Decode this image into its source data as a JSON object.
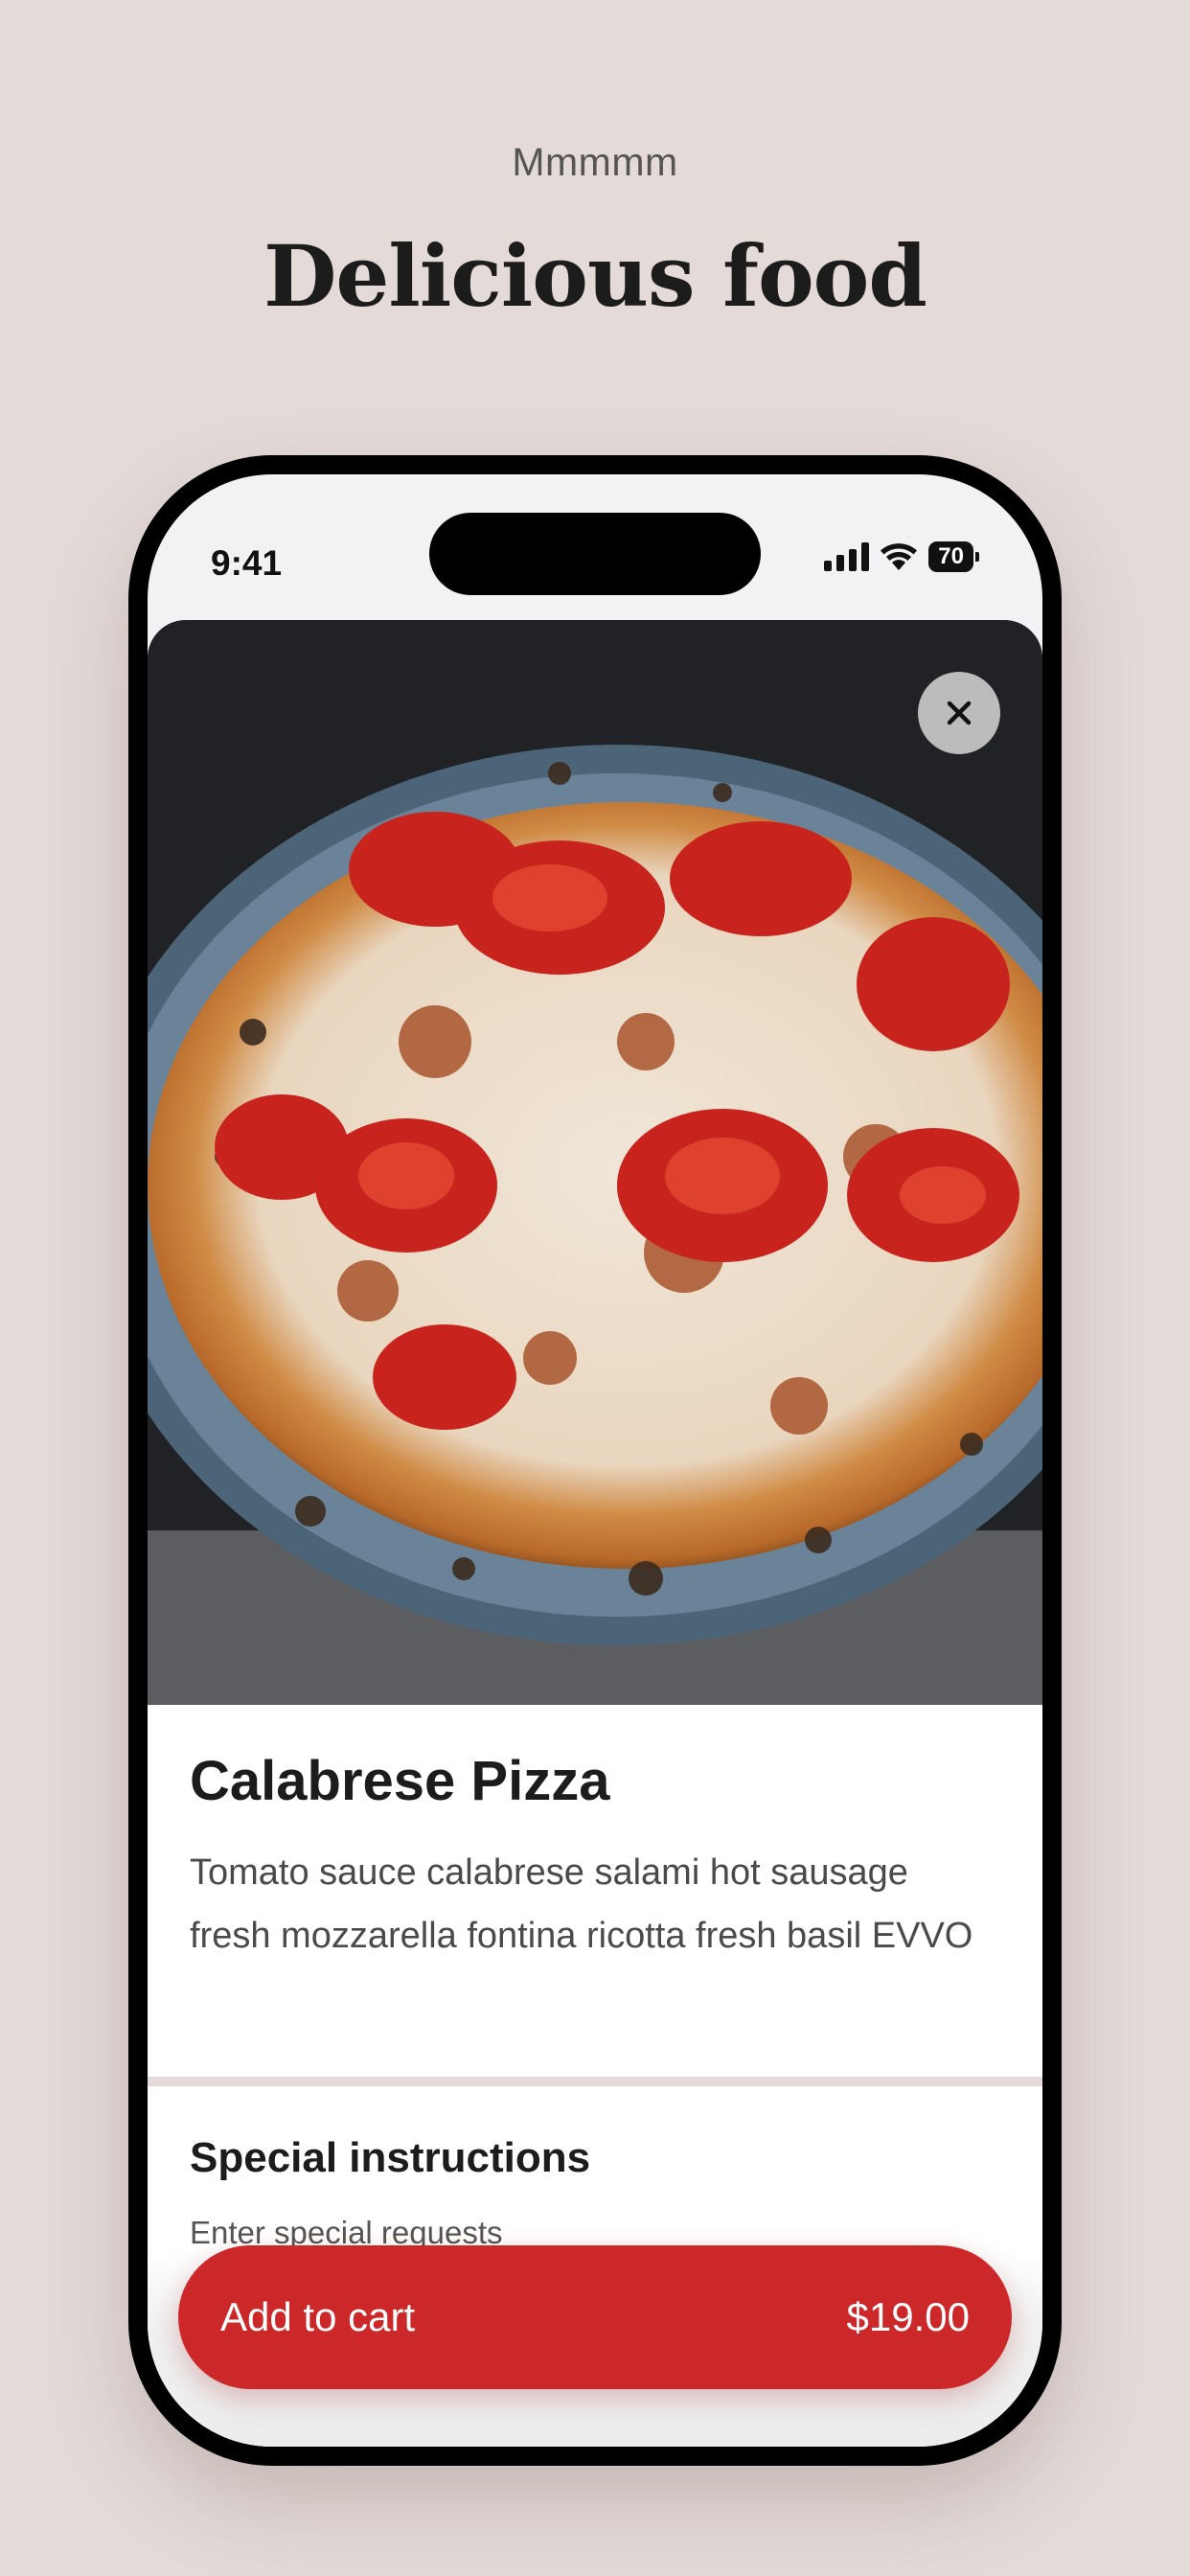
{
  "header": {
    "eyebrow": "Mmmmm",
    "title": "Delicious food"
  },
  "status_bar": {
    "time": "9:41",
    "battery": "70"
  },
  "product": {
    "name": "Calabrese Pizza",
    "description": "Tomato sauce calabrese salami hot sausage fresh mozzarella fontina ricotta fresh basil EVVO"
  },
  "special_instructions": {
    "title": "Special instructions",
    "placeholder": "Enter special requests"
  },
  "cart_button": {
    "label": "Add to cart",
    "price": "$19.00"
  },
  "colors": {
    "accent": "#cd2829",
    "background": "#e4dbd8"
  },
  "icons": [
    "signal-icon",
    "wifi-icon",
    "battery-icon",
    "close-icon"
  ]
}
